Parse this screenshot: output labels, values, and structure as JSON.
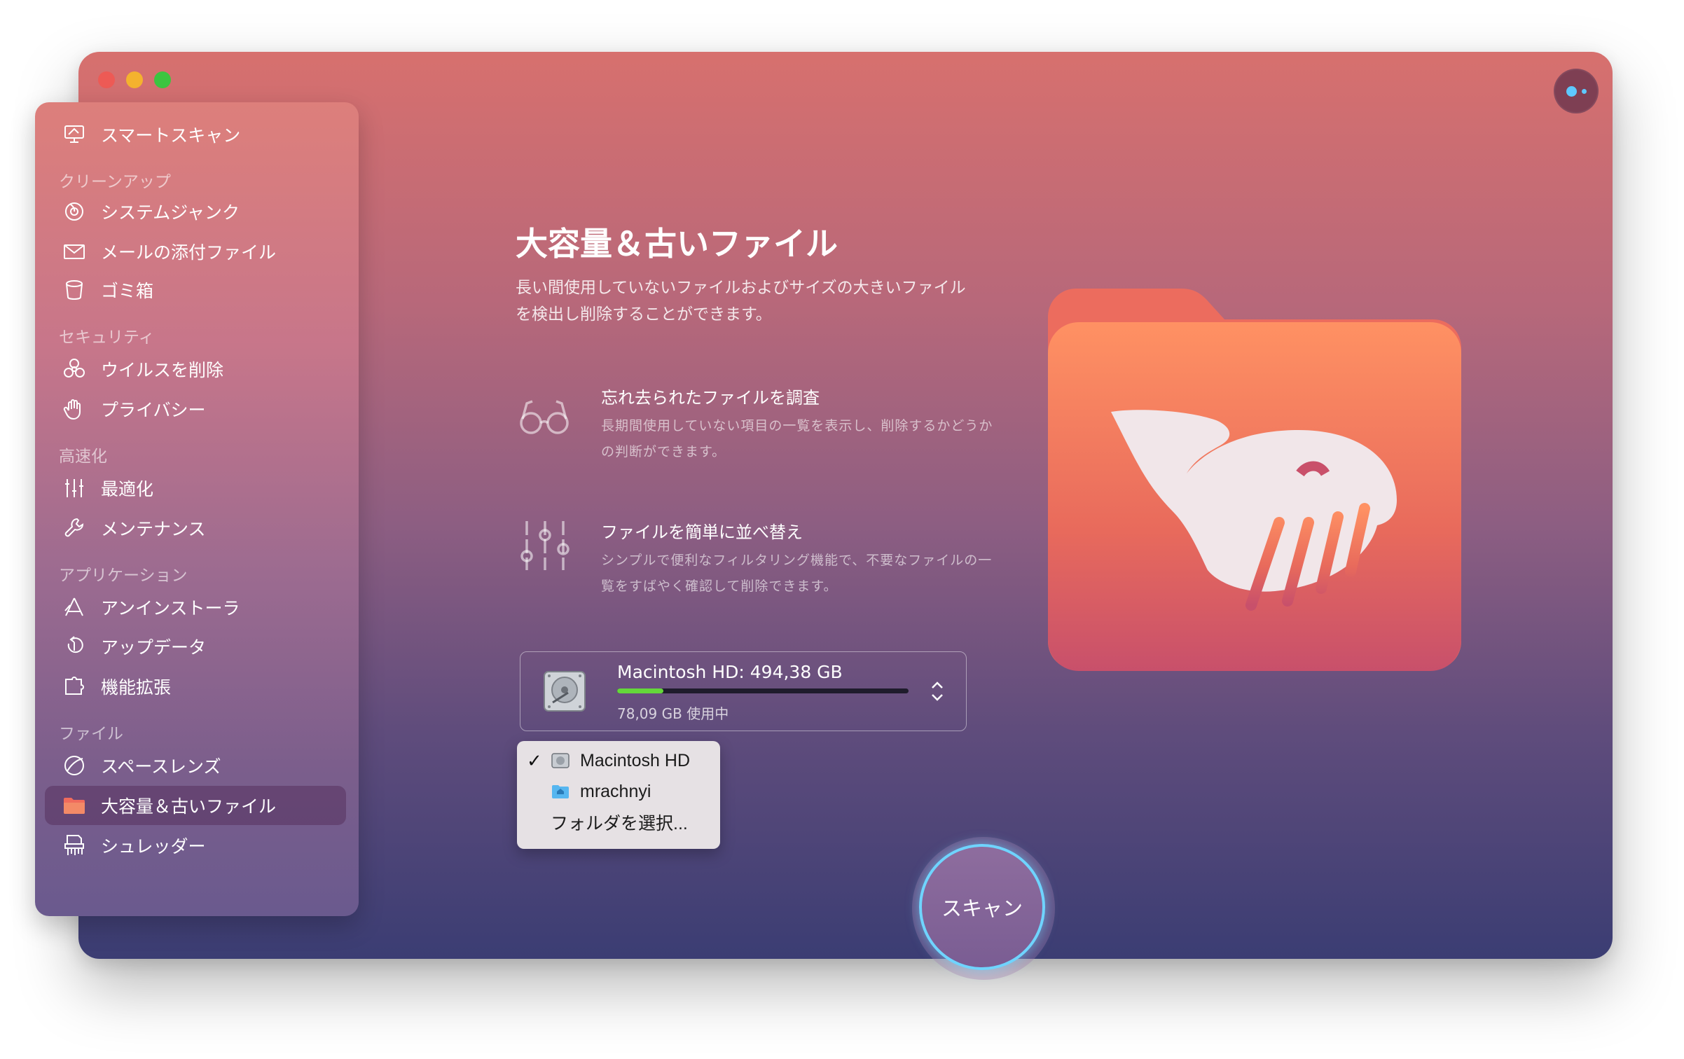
{
  "sidebar": {
    "smart_scan": "スマートスキャン",
    "sections": {
      "cleanup": "クリーンアップ",
      "security": "セキュリティ",
      "speed": "高速化",
      "applications": "アプリケーション",
      "files": "ファイル"
    },
    "items": {
      "system_junk": "システムジャンク",
      "mail_attachments": "メールの添付ファイル",
      "trash": "ゴミ箱",
      "malware_removal": "ウイルスを削除",
      "privacy": "プライバシー",
      "optimization": "最適化",
      "maintenance": "メンテナンス",
      "uninstaller": "アンインストーラ",
      "updater": "アップデータ",
      "extensions": "機能拡張",
      "space_lens": "スペースレンズ",
      "large_old_files": "大容量＆古いファイル",
      "shredder": "シュレッダー"
    },
    "active_item": "large_old_files"
  },
  "main": {
    "title": "大容量＆古いファイル",
    "description": "長い間使用していないファイルおよびサイズの大きいファイルを検出し削除することができます。",
    "features": [
      {
        "icon": "glasses-icon",
        "title": "忘れ去られたファイルを調査",
        "text": "長期間使用していない項目の一覧を表示し、削除するかどうかの判断ができます。"
      },
      {
        "icon": "sliders-icon",
        "title": "ファイルを簡単に並べ替え",
        "text": "シンプルで便利なフィルタリング機能で、不要なファイルの一覧をすばやく確認して削除できます。"
      }
    ],
    "disk": {
      "name": "Macintosh HD: 494,38 GB",
      "used": "78,09 GB 使用中",
      "usage_fraction": 0.158
    },
    "dropdown": {
      "items": [
        "Macintosh HD",
        "mrachnyi",
        "フォルダを選択..."
      ],
      "checked": "Macintosh HD"
    },
    "scan_label": "スキャン"
  },
  "colors": {
    "accent_ring": "#6fd4ff",
    "disk_fill": "#64d83a",
    "folder": "#ec6c5e"
  }
}
